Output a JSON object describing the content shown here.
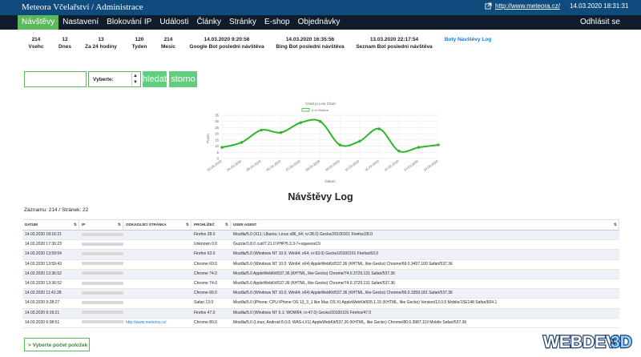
{
  "topbar": {
    "title": "Meteora Včelařství / Administrace",
    "site_link": "http://www.meteora.cz/",
    "datetime": "14.03.2020 18:31:31",
    "colors": {
      "bar": "#0f4c7d",
      "menu": "#101c2b",
      "accent": "#5cb85c"
    }
  },
  "menu": {
    "items": [
      {
        "label": "Návštěvy"
      },
      {
        "label": "Nastavení"
      },
      {
        "label": "Blokování IP"
      },
      {
        "label": "Události"
      },
      {
        "label": "Články"
      },
      {
        "label": "Stránky"
      },
      {
        "label": "E-shop"
      },
      {
        "label": "Objednávky"
      }
    ],
    "logout": "Odhlásit se"
  },
  "stats": [
    {
      "value": "214",
      "label": "Vsehc"
    },
    {
      "value": "12",
      "label": "Dnes"
    },
    {
      "value": "13",
      "label": "Za 24 hodiny"
    },
    {
      "value": "120",
      "label": "Tyden"
    },
    {
      "value": "214",
      "label": "Mesic"
    },
    {
      "value": "14.03.2020 9:20:56",
      "label": "Google Bot posledni návštěva"
    },
    {
      "value": "14.03.2020 16:35:56",
      "label": "Bing Bot posledni návštěva"
    },
    {
      "value": "13.03.2020 22:17:54",
      "label": "Seznam Bot posledni návštěva"
    },
    {
      "value": "",
      "label": "Boty Návštěvy Log"
    }
  ],
  "filter": {
    "input_value": "",
    "select_label": "Vyberte:",
    "search_button": "hledat",
    "reset_button": "storno"
  },
  "chart_data": {
    "type": "line",
    "title": "Chart.js Line Chart",
    "xlabel": "Datum",
    "ylabel": "Pocet",
    "ylim": [
      0,
      35
    ],
    "yticks": [
      0,
      5,
      10,
      15,
      20,
      25,
      30,
      35
    ],
    "series": [
      {
        "name": "# of Visitors",
        "color": "#2db52d",
        "x": [
          "03.03.2020",
          "04.03.2020",
          "05.03.2020",
          "06.03.2020",
          "07.03.2020",
          "08.03.2020",
          "09.03.2020",
          "10.03.2020",
          "11.03.2020",
          "12.03.2020",
          "13.03.2020",
          "14.03.2020"
        ],
        "values": [
          9,
          13,
          23,
          21,
          29,
          30,
          11,
          14,
          24,
          6,
          9,
          11
        ]
      }
    ],
    "grid": true,
    "legend": "top"
  },
  "log": {
    "title": "Návštěvy Log",
    "counts": "Záznamu: 214 / Stránek: 22",
    "columns": [
      "DATUM",
      "IP",
      "ODKAZUJÍCÍ STRÁNKA",
      "PROHLÍŽEČ",
      "USER AGENT"
    ],
    "rows": [
      {
        "date": "14.03.2020 18:16:21",
        "ref": "",
        "browser": "Firefox 28.0",
        "ua": "Mozilla/5.0 (X11; Ubuntu; Linux x86_64; rv:28.0) Gecko/20100101 Firefox/28.0"
      },
      {
        "date": "14.03.2020 17:36:23",
        "ref": "",
        "browser": "Unknown 0.0",
        "ua": "Guzzle/3.8.0 curl/7.21.0 PHP/5.3.3-7+squeeze19"
      },
      {
        "date": "14.03.2020 13:59:54",
        "ref": "",
        "browser": "Firefox 63.0",
        "ua": "Mozilla/5.0 (Windows NT 10.0; Win64; x64; rv:63.0) Gecko/20100101 Firefox/63.0"
      },
      {
        "date": "14.03.2020 13:59:43",
        "ref": "",
        "browser": "Chrome 69.0",
        "ua": "Mozilla/5.0 (Windows NT 10.0; Win64; x64) AppleWebKit/537.36 (KHTML, like Gecko) Chrome/69.0.3497.100 Safari/537.36"
      },
      {
        "date": "14.03.2020 13:36:52",
        "ref": "",
        "browser": "Chrome 74.0",
        "ua": "Mozilla/5.0 AppleWebKit/537.36 (KHTML, like Gecko) Chrome/74.0.3729.131 Safari/537.36"
      },
      {
        "date": "14.03.2020 13:36:52",
        "ref": "",
        "browser": "Chrome 74.0",
        "ua": "Mozilla/5.0 AppleWebKit/537.36 (KHTML, like Gecko) Chrome/74.0.3729.131 Safari/537.36"
      },
      {
        "date": "14.03.2020 11:41:28",
        "ref": "",
        "browser": "Chrome 66.0",
        "ua": "Mozilla/5.0 (Windows NT 10.0; Win64; x64) AppleWebKit/537.36 (KHTML, like Gecko) Chrome/66.0.3359.181 Safari/537.36"
      },
      {
        "date": "14.03.2020 9:28:27",
        "ref": "",
        "browser": "Safari 13.0",
        "ua": "Mozilla/5.0 (iPhone; CPU iPhone OS 13_3_1 like Mac OS X) AppleWebKit/605.1.15 (KHTML, like Gecko) Version/13.0.5 Mobile/15E148 Safari/604.1"
      },
      {
        "date": "14.03.2020 9:19:21",
        "ref": "",
        "browser": "Firefox 47.0",
        "ua": "Mozilla/5.0 (Windows NT 6.1; WOW64; rv:47.0) Gecko/20100101 Firefox/47.0"
      },
      {
        "date": "14.03.2020 6:08:51",
        "ref": "http://www.meteora.cz/",
        "browser": "Chrome 80.0",
        "ua": "Mozilla/5.0 (Linux; Android 8.0.0; WAS-LX1) AppleWebKit/537.36 (KHTML, like Gecko) Chrome/80.0.3987.119 Mobile Safari/537.36"
      }
    ],
    "more_button": "> Vyberte počet položek"
  },
  "watermark": {
    "text": "WEBDEV",
    "suffix": "3D"
  }
}
